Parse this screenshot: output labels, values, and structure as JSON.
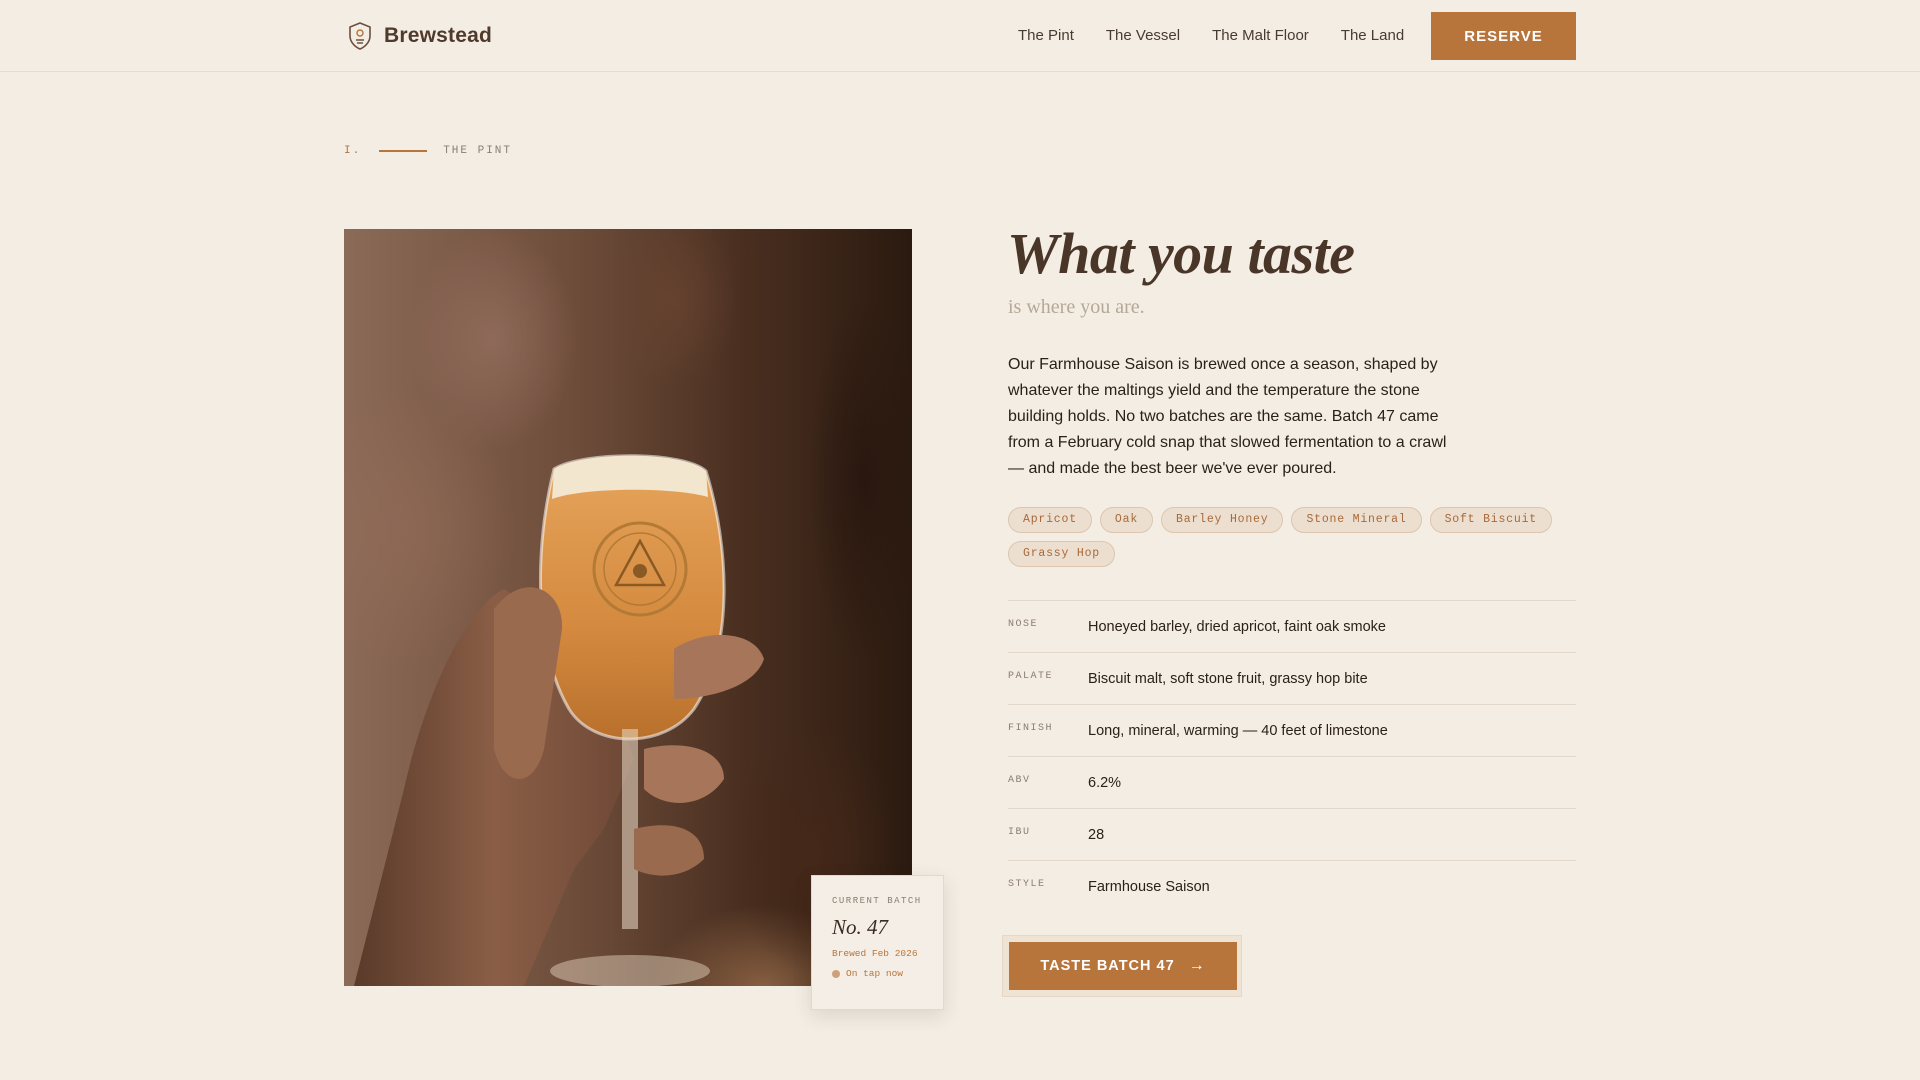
{
  "brand": {
    "name": "Brewstead",
    "icon": "shield-crest-icon"
  },
  "nav": {
    "items": [
      "The Pint",
      "The Vessel",
      "The Malt Floor",
      "The Land"
    ],
    "reserve_label": "RESERVE"
  },
  "section": {
    "number": "I.",
    "name": "THE PINT"
  },
  "hero": {
    "headline": "What you taste",
    "subhead": "is where you are.",
    "body": "Our Farmhouse Saison is brewed once a season, shaped by whatever the maltings yield and the temperature the stone building holds. No two batches are the same. Batch 47 came from a February cold snap that slowed fermentation to a crawl — and made the best beer we've ever poured."
  },
  "tags": [
    "Apricot",
    "Oak",
    "Barley Honey",
    "Stone Mineral",
    "Soft Biscuit",
    "Grassy Hop"
  ],
  "specs": [
    {
      "label": "NOSE",
      "value": "Honeyed barley, dried apricot, faint oak smoke"
    },
    {
      "label": "PALATE",
      "value": "Biscuit malt, soft stone fruit, grassy hop bite"
    },
    {
      "label": "FINISH",
      "value": "Long, mineral, warming — 40 feet of limestone"
    },
    {
      "label": "ABV",
      "value": "6.2%"
    },
    {
      "label": "IBU",
      "value": "28"
    },
    {
      "label": "STYLE",
      "value": "Farmhouse Saison"
    }
  ],
  "batch": {
    "eyebrow": "CURRENT BATCH",
    "number": "No. 47",
    "brewed": "Brewed Feb 2026",
    "status": "On tap now"
  },
  "cta": {
    "label": "TASTE BATCH 47",
    "icon": "arrow-right-icon"
  },
  "colors": {
    "accent": "#b8753b",
    "background": "#f3ede3",
    "text": "#2b2118"
  }
}
